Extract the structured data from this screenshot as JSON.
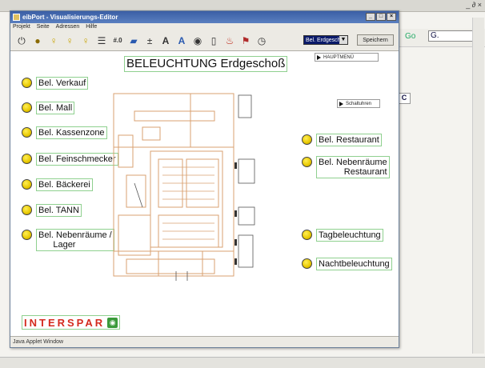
{
  "app": {
    "window_title": "eibPort - Visualisierungs-Editor",
    "menu": [
      "Projekt",
      "Seite",
      "Adressen",
      "Hilfe"
    ],
    "toolbar": {
      "floor_value": "Bel. Erdgesch",
      "save_label": "Speichern",
      "tool_icons": [
        "power-icon",
        "bulb-dark-icon",
        "bulb-icon",
        "bulb-switch-icon",
        "bulb-dim-icon",
        "list-icon",
        "value-icon",
        "display-icon",
        "plus-minus-icon",
        "text-a-icon",
        "text-a-up-icon",
        "eye-icon",
        "page-icon",
        "thermo-icon",
        "flag-icon",
        "clock-icon"
      ],
      "value_icon_text": "#.0"
    },
    "status_text": "Java Applet Window"
  },
  "page": {
    "title": "BELEUCHTUNG Erdgeschoß",
    "nav_main": "HAUPTMENÜ",
    "nav_timers": "Schaltuhren"
  },
  "left_buttons": [
    {
      "label": "Bel. Verkauf"
    },
    {
      "label": "Bel. Mall"
    },
    {
      "label": "Bel. Kassenzone"
    },
    {
      "label": "Bel. Feinschmecker"
    },
    {
      "label": "Bel. Bäckerei"
    },
    {
      "label": "Bel. TANN"
    },
    {
      "label": "Bel. Nebenräume /\n      Lager"
    }
  ],
  "right_buttons": [
    {
      "label": "Bel. Restaurant"
    },
    {
      "label": "Bel. Nebenräume\nRestaurant"
    },
    {
      "label": "Tagbeleuchtung"
    },
    {
      "label": "Nachtbeleuchtung"
    }
  ],
  "logo": {
    "text": "INTERSPAR"
  },
  "background": {
    "go_label": "Go",
    "search_value": "G.",
    "side_label": "C",
    "window_controls": "_ ∂ ×"
  },
  "colors": {
    "highlight_border": "#8fd08f",
    "bulb": "#e8c800",
    "logo_red": "#d42a1e",
    "plan_lines": "#d9a070"
  }
}
